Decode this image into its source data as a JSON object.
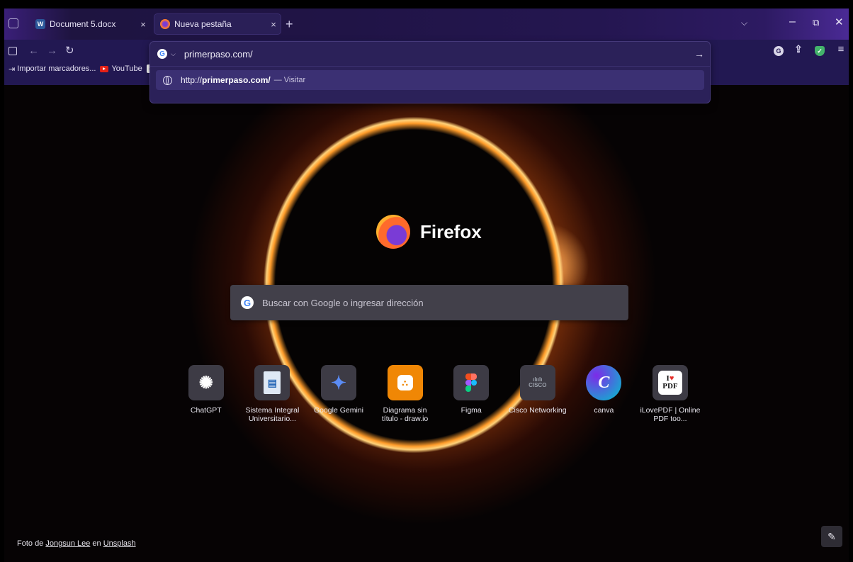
{
  "tabs": [
    {
      "label": "Document 5.docx",
      "icon": "word-doc-icon",
      "active": false
    },
    {
      "label": "Nueva pestaña",
      "icon": "firefox-icon",
      "active": true
    }
  ],
  "tab_controls": {
    "close": "×",
    "new_tab": "+",
    "overflow": "⌵",
    "minimize": "–",
    "restore": "⧉",
    "close_window": "✕"
  },
  "nav": {
    "back": "←",
    "forward": "→",
    "reload": "↻",
    "menu": "≡",
    "share": "⇪",
    "ext_g": "G",
    "ext_shield": "✓"
  },
  "bookmarks": [
    {
      "label": "Importar marcadores...",
      "icon": "import-icon"
    },
    {
      "label": "YouTube",
      "icon": "youtube-icon"
    }
  ],
  "url_bar": {
    "value": "primerpaso.com/",
    "engine_icon": "google-icon",
    "go": "→",
    "suggestion": {
      "prefix": "http://",
      "host": "primerpaso.com/",
      "action": "— Visitar"
    }
  },
  "newtab": {
    "brand": "Firefox",
    "search_placeholder": "Buscar con Google o ingresar dirección",
    "tiles": [
      {
        "label": "ChatGPT",
        "icon": "chatgpt-icon"
      },
      {
        "label": "Sistema Integral Universitario...",
        "icon": "document-icon"
      },
      {
        "label": "Google Gemini",
        "icon": "gemini-icon"
      },
      {
        "label": "Diagrama sin título - draw.io",
        "icon": "drawio-icon"
      },
      {
        "label": "Figma",
        "icon": "figma-icon"
      },
      {
        "label": "Cisco Networking",
        "icon": "cisco-icon"
      },
      {
        "label": "canva",
        "icon": "canva-icon"
      },
      {
        "label": "iLovePDF | Online PDF too...",
        "icon": "ilovepdf-icon"
      }
    ],
    "credit": {
      "prefix": "Foto de ",
      "author": "Jongsun Lee",
      "middle": " en ",
      "source": "Unsplash"
    },
    "edit_icon": "pencil-icon"
  },
  "colors": {
    "tabbar": "#201446",
    "navbar": "#221852",
    "url_panel": "#2b2159",
    "search_box": "#42404a",
    "tile_box": "#3d3b45"
  }
}
